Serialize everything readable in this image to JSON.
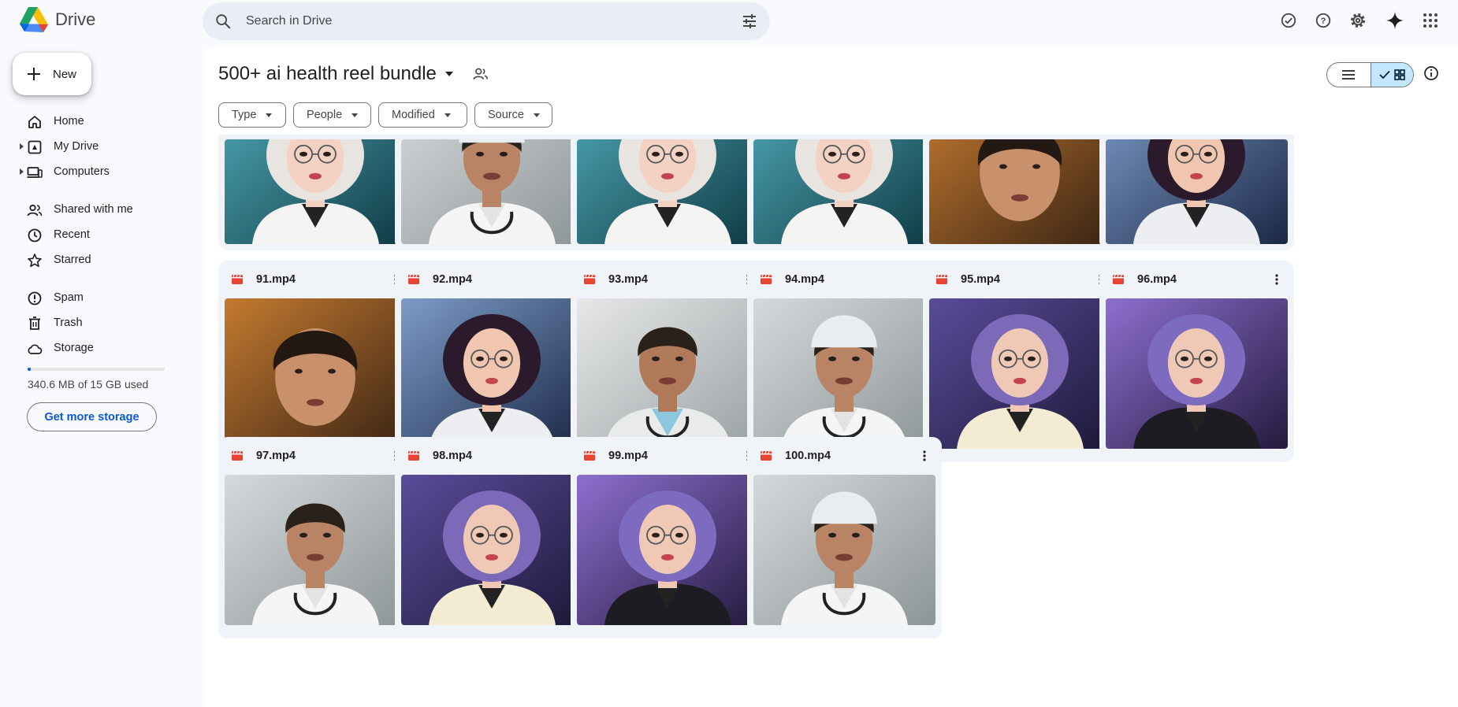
{
  "app": {
    "name": "Drive"
  },
  "search": {
    "placeholder": "Search in Drive"
  },
  "top_actions": [
    "offline-ready-icon",
    "help-icon",
    "settings-icon",
    "gemini-icon",
    "apps-grid-icon"
  ],
  "new_button": {
    "label": "New"
  },
  "sidebar": {
    "items": [
      {
        "label": "Home",
        "icon": "home-icon"
      },
      {
        "label": "My Drive",
        "icon": "my-drive-icon",
        "expandable": true
      },
      {
        "label": "Computers",
        "icon": "computers-icon",
        "expandable": true
      },
      {
        "label": "Shared with me",
        "icon": "shared-icon"
      },
      {
        "label": "Recent",
        "icon": "clock-icon"
      },
      {
        "label": "Starred",
        "icon": "star-icon"
      },
      {
        "label": "Spam",
        "icon": "spam-icon"
      },
      {
        "label": "Trash",
        "icon": "trash-icon"
      },
      {
        "label": "Storage",
        "icon": "cloud-icon"
      }
    ],
    "storage": {
      "used_text": "340.6 MB of 15 GB used",
      "used_fraction": 0.022,
      "button_label": "Get more storage"
    }
  },
  "folder": {
    "title": "500+ ai health reel bundle"
  },
  "view": {
    "mode": "grid"
  },
  "filters": [
    {
      "label": "Type"
    },
    {
      "label": "People"
    },
    {
      "label": "Modified"
    },
    {
      "label": "Source"
    }
  ],
  "files": {
    "top_row_thumbnails": [
      "blonde-nurse",
      "male-doctor-cap",
      "blonde-nurse",
      "blonde-nurse",
      "man-closeup",
      "dark-hair-woman-glasses"
    ],
    "items": [
      {
        "name": "91.mp4",
        "thumb": "man-closeup"
      },
      {
        "name": "92.mp4",
        "thumb": "dark-hair-woman-glasses"
      },
      {
        "name": "93.mp4",
        "thumb": "male-doctor-stethoscope"
      },
      {
        "name": "94.mp4",
        "thumb": "male-doctor-cap"
      },
      {
        "name": "95.mp4",
        "thumb": "purple-hair-woman-coat"
      },
      {
        "name": "96.mp4",
        "thumb": "purple-hair-woman"
      },
      {
        "name": "97.mp4",
        "thumb": "male-doctor-no-cap"
      },
      {
        "name": "98.mp4",
        "thumb": "purple-hair-woman-coat"
      },
      {
        "name": "99.mp4",
        "thumb": "purple-hair-woman"
      },
      {
        "name": "100.mp4",
        "thumb": "male-doctor-cap"
      }
    ]
  },
  "colors": {
    "accent": "#0b57d0",
    "video_icon": "#ea4335",
    "surface": "#f0f4f9",
    "selected": "#c2e7ff"
  }
}
